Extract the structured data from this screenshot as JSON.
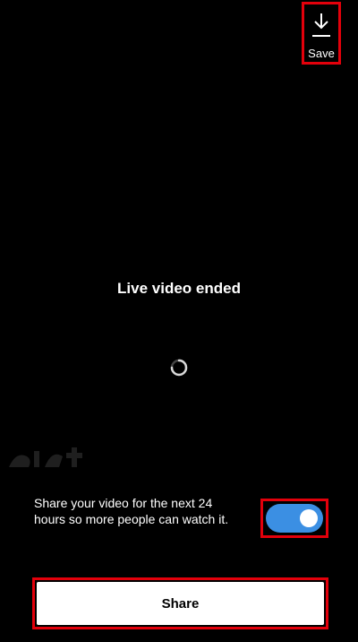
{
  "header": {
    "save_label": "Save",
    "save_icon": "download-icon"
  },
  "main": {
    "title": "Live video ended",
    "spinner_icon": "loading-spinner-icon"
  },
  "share_option": {
    "description": "Share your video for the next 24 hours so more people can watch it.",
    "toggle_on": true,
    "toggle_color": "#3b8fe3"
  },
  "footer": {
    "share_label": "Share"
  },
  "colors": {
    "background": "#000000",
    "highlight": "#e3000b"
  }
}
